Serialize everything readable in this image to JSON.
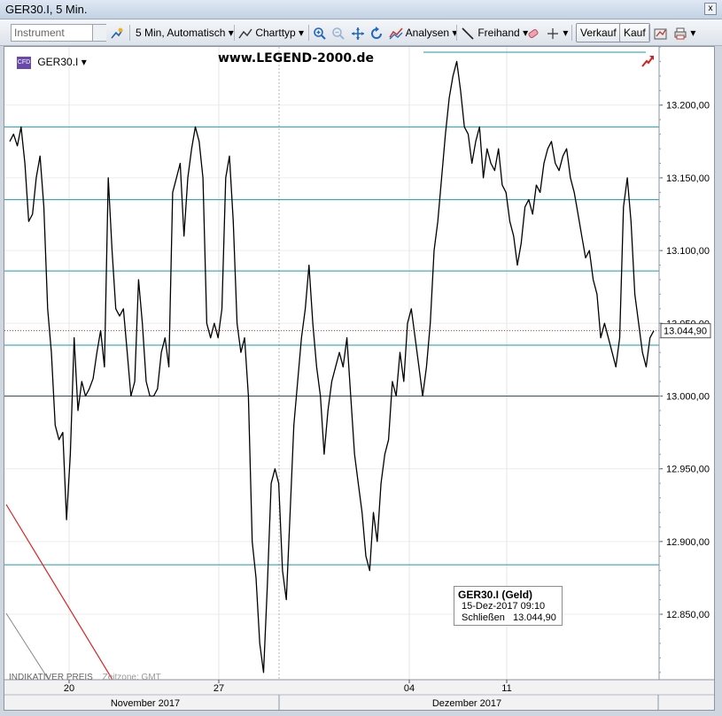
{
  "window": {
    "title": "GER30.I, 5 Min.",
    "close_label": "x"
  },
  "toolbar": {
    "instrument_placeholder": "Instrument",
    "interval_label": "5 Min,  Automatisch",
    "charttype_label": "Charttyp",
    "analysen_label": "Analysen",
    "freihand_label": "Freihand",
    "verkauf_label": "Verkauf",
    "kauf_label": "Kauf",
    "dropdown_glyph": "▾"
  },
  "chart_header": {
    "instrument": "GER30.I",
    "instrument_icon": "CFD",
    "watermark": "www.LEGEND-2000.de"
  },
  "tooltip": {
    "title": "GER30.I (Geld)",
    "date": "15-Dez-2017 09:10",
    "close_label": "Schließen",
    "close_value": "13.044,90"
  },
  "indicator": {
    "label": "INDIKATIVER PREIS",
    "zone": "Zeitzone: GMT"
  },
  "colors": {
    "hline": "#1c9aa8",
    "price_line": "#c0392b",
    "current_box": "#ffffff",
    "trend_red": "#e02020",
    "trend_gray": "#888888"
  },
  "chart_data": {
    "type": "line",
    "title": "GER30.I, 5 Min.",
    "ylim": [
      12805,
      13240
    ],
    "y_ticks": [
      "13.200,00",
      "13.150,00",
      "13.100,00",
      "13.050,00",
      "13.000,00",
      "12.950,00",
      "12.900,00",
      "12.850,00"
    ],
    "y_tick_values": [
      13200,
      13150,
      13100,
      13050,
      13000,
      12950,
      12900,
      12850
    ],
    "x_ticks": [
      "20",
      "27",
      "04",
      "11"
    ],
    "x_months": [
      "November 2017",
      "Dezember 2017"
    ],
    "current_price": 13044.9,
    "current_price_label": "13.044,90",
    "horizontal_levels": [
      13185,
      13135,
      13086,
      13035,
      12884
    ],
    "dark_level": 13000,
    "series": [
      {
        "values": [
          13175,
          13180,
          13172,
          13185,
          13160,
          13120,
          13125,
          13150,
          13165,
          13130,
          13060,
          13030,
          12980,
          12970,
          12975,
          12915,
          12960,
          13040,
          12990,
          13010,
          13000,
          13005,
          13012,
          13030,
          13045,
          13020,
          13150,
          13100,
          13060,
          13055,
          13060,
          13030,
          13000,
          13010,
          13080,
          13050,
          13010,
          13000,
          13000,
          13005,
          13030,
          13040,
          13020,
          13140,
          13150,
          13160,
          13110,
          13150,
          13170,
          13185,
          13175,
          13150,
          13050,
          13040,
          13050,
          13040,
          13060,
          13150,
          13165,
          13120,
          13050,
          13030,
          13040,
          13000,
          12900,
          12875,
          12830,
          12810,
          12870,
          12940,
          12950,
          12940,
          12880,
          12860,
          12920,
          12980,
          13010,
          13040,
          13060,
          13090,
          13050,
          13020,
          13000,
          12960,
          12990,
          13010,
          13020,
          13030,
          13020,
          13040,
          13000,
          12960,
          12940,
          12920,
          12890,
          12880,
          12920,
          12900,
          12940,
          12960,
          12970,
          13010,
          13000,
          13030,
          13010,
          13050,
          13060,
          13040,
          13020,
          13000,
          13020,
          13050,
          13100,
          13120,
          13150,
          13180,
          13205,
          13220,
          13230,
          13210,
          13185,
          13180,
          13160,
          13175,
          13185,
          13150,
          13170,
          13160,
          13155,
          13170,
          13145,
          13140,
          13120,
          13110,
          13090,
          13105,
          13130,
          13135,
          13125,
          13145,
          13140,
          13160,
          13170,
          13175,
          13160,
          13155,
          13165,
          13170,
          13150,
          13140,
          13125,
          13110,
          13095,
          13100,
          13080,
          13070,
          13040,
          13050,
          13040,
          13030,
          13020,
          13040,
          13130,
          13150,
          13120,
          13070,
          13050,
          13030,
          13020,
          13040,
          13044.9
        ]
      }
    ]
  }
}
